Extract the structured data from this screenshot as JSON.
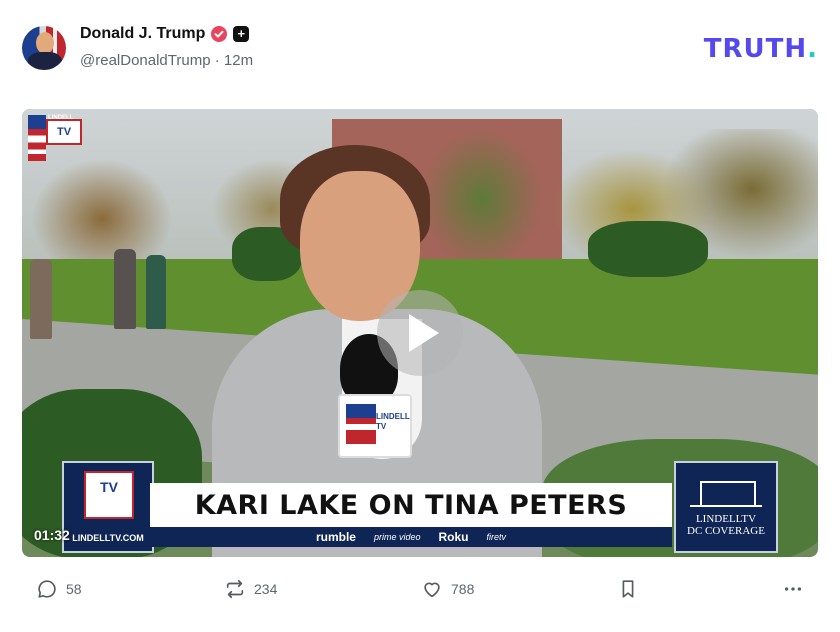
{
  "post": {
    "author_name": "Donald J. Trump",
    "handle": "@realDonaldTrump",
    "time_separator": "·",
    "time_ago": "12m"
  },
  "brand": {
    "name": "TRUTH",
    "dot": ".",
    "color": "#5448ee",
    "dot_color": "#16d0c6"
  },
  "video": {
    "timestamp": "01:32",
    "corner_logo_text": "TV",
    "corner_logo_small": "LINDELL",
    "lower_third": {
      "logo_text": "TV",
      "site": "LINDELLTV.COM",
      "headline": "KARI LAKE ON TINA PETERS",
      "partners": [
        "rumble",
        "prime video",
        "Roku",
        "firetv"
      ],
      "right_line1": "LINDELLTV",
      "right_line2": "DC COVERAGE"
    },
    "mic_flag_text": "LINDELL TV"
  },
  "actions": {
    "reply_count": "58",
    "repost_count": "234",
    "like_count": "788"
  },
  "icons": {
    "verified": "verified-badge-icon",
    "plus": "plus-badge-icon",
    "play": "play-icon",
    "reply": "comment-icon",
    "repost": "repost-icon",
    "like": "heart-icon",
    "bookmark": "bookmark-icon",
    "more": "more-dots-icon"
  }
}
